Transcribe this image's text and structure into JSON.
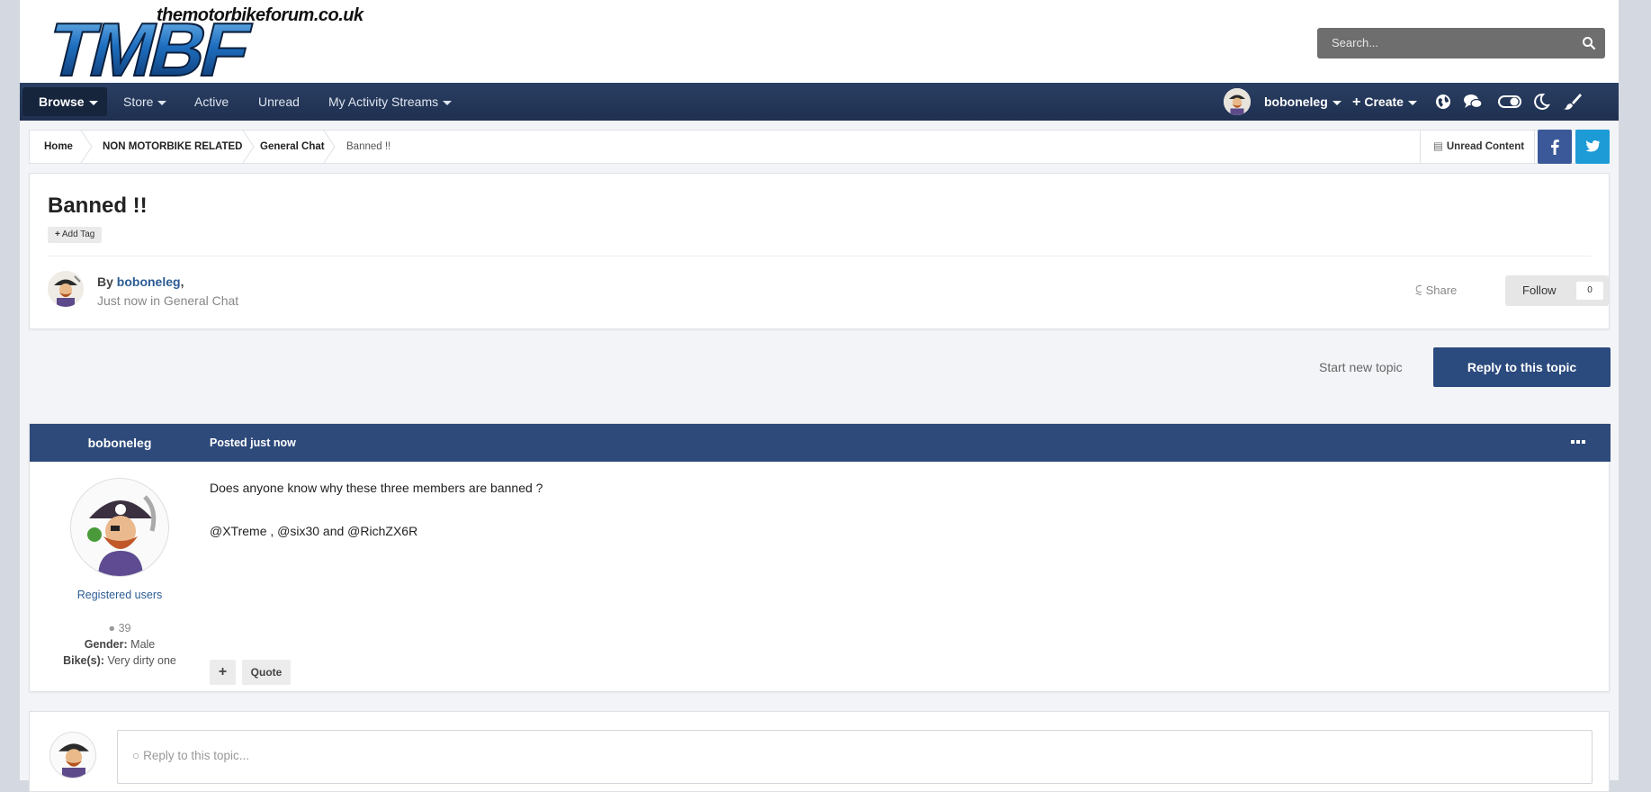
{
  "header": {
    "logo_site": "themotorbikeforum.co.uk",
    "logo_letters": "TMBF",
    "search_placeholder": "Search..."
  },
  "nav": {
    "items": [
      {
        "label": "Browse",
        "dropdown": true,
        "active": true
      },
      {
        "label": "Store",
        "dropdown": true
      },
      {
        "label": "Active"
      },
      {
        "label": "Unread"
      },
      {
        "label": "My Activity Streams",
        "dropdown": true
      }
    ],
    "user": "boboneleg",
    "create": "Create",
    "icons": [
      "globe-icon",
      "chat-icon",
      "toggle-icon",
      "moon-icon",
      "brush-icon"
    ]
  },
  "breadcrumb": {
    "items": [
      "Home",
      "NON MOTORBIKE RELATED",
      "General Chat",
      "Banned !!"
    ],
    "unread_content": "Unread Content"
  },
  "topic": {
    "title": "Banned !!",
    "add_tag": "Add Tag",
    "by": "By",
    "author": "boboneleg",
    "posted": "Just now in General Chat",
    "share": "Share",
    "follow": "Follow",
    "follow_count": "0"
  },
  "actions": {
    "start_new": "Start new topic",
    "reply": "Reply to this topic"
  },
  "post": {
    "author": "boboneleg",
    "date": "Posted just now",
    "group": "Registered users",
    "post_count": "39",
    "gender_label": "Gender:",
    "gender": "Male",
    "bikes_label": "Bike(s):",
    "bikes": "Very dirty one",
    "lines": [
      "Does anyone know why these three members are banned ?",
      "@XTreme , @six30 and @RichZX6R"
    ],
    "quote": "Quote"
  },
  "reply_box": {
    "placeholder": "Reply to this topic..."
  },
  "colors": {
    "nav_bg": "#1f3050",
    "post_header": "#2e4a7a",
    "primary_button": "#2b4a7d",
    "link": "#2b5c94",
    "facebook": "#3b5998",
    "twitter": "#1d9bd7"
  }
}
